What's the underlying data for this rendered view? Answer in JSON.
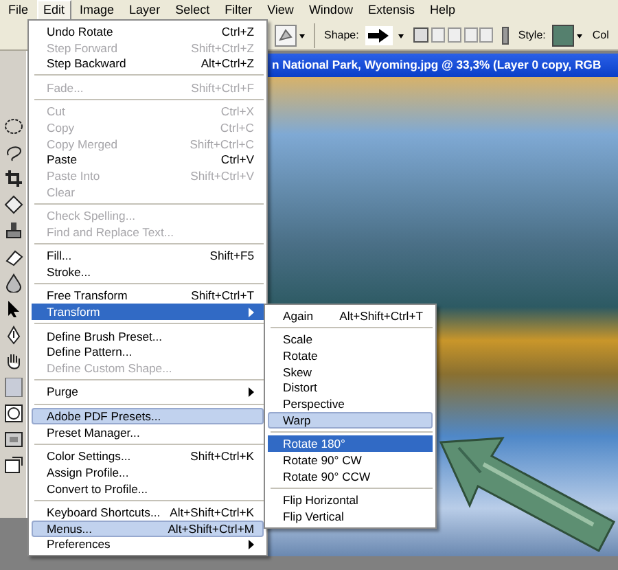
{
  "menubar": [
    {
      "label": "File",
      "selected": false
    },
    {
      "label": "Edit",
      "selected": true
    },
    {
      "label": "Image",
      "selected": false
    },
    {
      "label": "Layer",
      "selected": false
    },
    {
      "label": "Select",
      "selected": false
    },
    {
      "label": "Filter",
      "selected": false
    },
    {
      "label": "View",
      "selected": false
    },
    {
      "label": "Window",
      "selected": false
    },
    {
      "label": "Extensis",
      "selected": false
    },
    {
      "label": "Help",
      "selected": false
    }
  ],
  "options_bar": {
    "shape_label": "Shape:",
    "style_label": "Style:",
    "color_label": "Col"
  },
  "document": {
    "title": "n National Park, Wyoming.jpg @ 33,3% (Layer 0 copy, RGB"
  },
  "edit_menu": {
    "items": [
      {
        "kind": "item",
        "label": "Undo Rotate",
        "shortcut": "Ctrl+Z",
        "disabled": false,
        "selected": false,
        "highlighted": false,
        "submenu": false
      },
      {
        "kind": "item",
        "label": "Step Forward",
        "shortcut": "Shift+Ctrl+Z",
        "disabled": true,
        "selected": false,
        "highlighted": false,
        "submenu": false
      },
      {
        "kind": "item",
        "label": "Step Backward",
        "shortcut": "Alt+Ctrl+Z",
        "disabled": false,
        "selected": false,
        "highlighted": false,
        "submenu": false
      },
      {
        "kind": "separator"
      },
      {
        "kind": "item",
        "label": "Fade...",
        "shortcut": "Shift+Ctrl+F",
        "disabled": true,
        "selected": false,
        "highlighted": false,
        "submenu": false
      },
      {
        "kind": "separator"
      },
      {
        "kind": "item",
        "label": "Cut",
        "shortcut": "Ctrl+X",
        "disabled": true,
        "selected": false,
        "highlighted": false,
        "submenu": false
      },
      {
        "kind": "item",
        "label": "Copy",
        "shortcut": "Ctrl+C",
        "disabled": true,
        "selected": false,
        "highlighted": false,
        "submenu": false
      },
      {
        "kind": "item",
        "label": "Copy Merged",
        "shortcut": "Shift+Ctrl+C",
        "disabled": true,
        "selected": false,
        "highlighted": false,
        "submenu": false
      },
      {
        "kind": "item",
        "label": "Paste",
        "shortcut": "Ctrl+V",
        "disabled": false,
        "selected": false,
        "highlighted": false,
        "submenu": false
      },
      {
        "kind": "item",
        "label": "Paste Into",
        "shortcut": "Shift+Ctrl+V",
        "disabled": true,
        "selected": false,
        "highlighted": false,
        "submenu": false
      },
      {
        "kind": "item",
        "label": "Clear",
        "disabled": true,
        "selected": false,
        "highlighted": false,
        "submenu": false
      },
      {
        "kind": "separator"
      },
      {
        "kind": "item",
        "label": "Check Spelling...",
        "disabled": true,
        "selected": false,
        "highlighted": false,
        "submenu": false
      },
      {
        "kind": "item",
        "label": "Find and Replace Text...",
        "disabled": true,
        "selected": false,
        "highlighted": false,
        "submenu": false
      },
      {
        "kind": "separator"
      },
      {
        "kind": "item",
        "label": "Fill...",
        "shortcut": "Shift+F5",
        "disabled": false,
        "selected": false,
        "highlighted": false,
        "submenu": false
      },
      {
        "kind": "item",
        "label": "Stroke...",
        "disabled": false,
        "selected": false,
        "highlighted": false,
        "submenu": false
      },
      {
        "kind": "separator"
      },
      {
        "kind": "item",
        "label": "Free Transform",
        "shortcut": "Shift+Ctrl+T",
        "disabled": false,
        "selected": false,
        "highlighted": false,
        "submenu": false
      },
      {
        "kind": "item",
        "label": "Transform",
        "disabled": false,
        "selected": true,
        "highlighted": false,
        "submenu": true
      },
      {
        "kind": "separator"
      },
      {
        "kind": "item",
        "label": "Define Brush Preset...",
        "disabled": false,
        "selected": false,
        "highlighted": false,
        "submenu": false
      },
      {
        "kind": "item",
        "label": "Define Pattern...",
        "disabled": false,
        "selected": false,
        "highlighted": false,
        "submenu": false
      },
      {
        "kind": "item",
        "label": "Define Custom Shape...",
        "disabled": true,
        "selected": false,
        "highlighted": false,
        "submenu": false
      },
      {
        "kind": "separator"
      },
      {
        "kind": "item",
        "label": "Purge",
        "disabled": false,
        "selected": false,
        "highlighted": false,
        "submenu": true
      },
      {
        "kind": "separator"
      },
      {
        "kind": "item",
        "label": "Adobe PDF Presets...",
        "disabled": false,
        "selected": false,
        "highlighted": true,
        "submenu": false
      },
      {
        "kind": "item",
        "label": "Preset Manager...",
        "disabled": false,
        "selected": false,
        "highlighted": false,
        "submenu": false
      },
      {
        "kind": "separator"
      },
      {
        "kind": "item",
        "label": "Color Settings...",
        "shortcut": "Shift+Ctrl+K",
        "disabled": false,
        "selected": false,
        "highlighted": false,
        "submenu": false
      },
      {
        "kind": "item",
        "label": "Assign Profile...",
        "disabled": false,
        "selected": false,
        "highlighted": false,
        "submenu": false
      },
      {
        "kind": "item",
        "label": "Convert to Profile...",
        "disabled": false,
        "selected": false,
        "highlighted": false,
        "submenu": false
      },
      {
        "kind": "separator"
      },
      {
        "kind": "item",
        "label": "Keyboard Shortcuts...",
        "shortcut": "Alt+Shift+Ctrl+K",
        "disabled": false,
        "selected": false,
        "highlighted": false,
        "submenu": false
      },
      {
        "kind": "item",
        "label": "Menus...",
        "shortcut": "Alt+Shift+Ctrl+M",
        "disabled": false,
        "selected": false,
        "highlighted": true,
        "submenu": false
      },
      {
        "kind": "item",
        "label": "Preferences",
        "disabled": false,
        "selected": false,
        "highlighted": false,
        "submenu": true
      }
    ]
  },
  "transform_menu": {
    "items": [
      {
        "kind": "item",
        "label": "Again",
        "shortcut": "Alt+Shift+Ctrl+T",
        "disabled": false,
        "selected": false,
        "highlighted": false,
        "submenu": false
      },
      {
        "kind": "separator"
      },
      {
        "kind": "item",
        "label": "Scale",
        "disabled": false,
        "selected": false,
        "highlighted": false,
        "submenu": false
      },
      {
        "kind": "item",
        "label": "Rotate",
        "disabled": false,
        "selected": false,
        "highlighted": false,
        "submenu": false
      },
      {
        "kind": "item",
        "label": "Skew",
        "disabled": false,
        "selected": false,
        "highlighted": false,
        "submenu": false
      },
      {
        "kind": "item",
        "label": "Distort",
        "disabled": false,
        "selected": false,
        "highlighted": false,
        "submenu": false
      },
      {
        "kind": "item",
        "label": "Perspective",
        "disabled": false,
        "selected": false,
        "highlighted": false,
        "submenu": false
      },
      {
        "kind": "item",
        "label": "Warp",
        "disabled": false,
        "selected": false,
        "highlighted": true,
        "submenu": false
      },
      {
        "kind": "separator"
      },
      {
        "kind": "item",
        "label": "Rotate 180°",
        "disabled": false,
        "selected": true,
        "highlighted": false,
        "submenu": false
      },
      {
        "kind": "item",
        "label": "Rotate 90° CW",
        "disabled": false,
        "selected": false,
        "highlighted": false,
        "submenu": false
      },
      {
        "kind": "item",
        "label": "Rotate 90° CCW",
        "disabled": false,
        "selected": false,
        "highlighted": false,
        "submenu": false
      },
      {
        "kind": "separator"
      },
      {
        "kind": "item",
        "label": "Flip Horizontal",
        "disabled": false,
        "selected": false,
        "highlighted": false,
        "submenu": false
      },
      {
        "kind": "item",
        "label": "Flip Vertical",
        "disabled": false,
        "selected": false,
        "highlighted": false,
        "submenu": false
      }
    ]
  }
}
